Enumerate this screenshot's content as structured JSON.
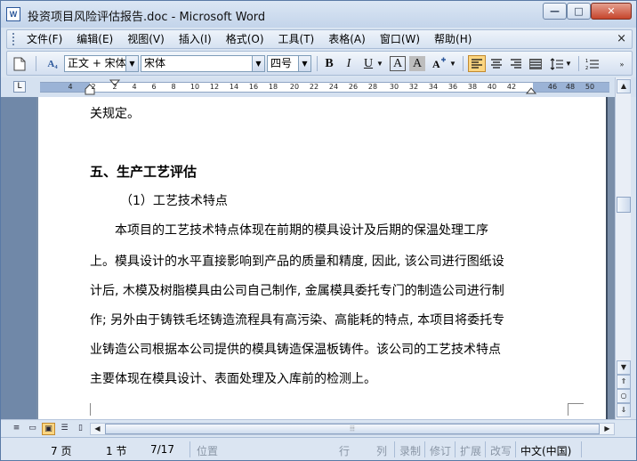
{
  "window": {
    "title": "投资项目风险评估报告.doc - Microsoft Word",
    "icon_label": "W",
    "minimize": "—",
    "maximize": "□",
    "close": "✕"
  },
  "menu": {
    "items": [
      "文件(F)",
      "编辑(E)",
      "视图(V)",
      "插入(I)",
      "格式(O)",
      "工具(T)",
      "表格(A)",
      "窗口(W)",
      "帮助(H)"
    ],
    "close": "×"
  },
  "toolbar": {
    "style_value": "正文 + 宋体",
    "font_value": "宋体",
    "size_value": "四号",
    "bold": "B",
    "italic": "I",
    "underline": "U",
    "char_border": "A",
    "char_shading": "A",
    "style_icon": "A₄"
  },
  "ruler": {
    "corner": "L",
    "ticks": [
      "4",
      "2",
      "2",
      "4",
      "6",
      "8",
      "10",
      "12",
      "14",
      "16",
      "18",
      "20",
      "22",
      "24",
      "26",
      "28",
      "30",
      "32",
      "34",
      "36",
      "38",
      "40",
      "42",
      "46",
      "48",
      "50"
    ]
  },
  "document": {
    "line1": "关规定。",
    "heading": "五、生产工艺评估",
    "subheading": "（1）工艺技术特点",
    "para": [
      "　　本项目的工艺技术特点体现在前期的模具设计及后期的保温处理工序",
      "上。模具设计的水平直接影响到产品的质量和精度, 因此, 该公司进行图纸设",
      "计后, 木模及树脂模具由公司自己制作, 金属模具委托专门的制造公司进行制",
      "作; 另外由于铸铁毛坯铸造流程具有高污染、高能耗的特点, 本项目将委托专",
      "业铸造公司根据本公司提供的模具铸造保温板铸件。该公司的工艺技术特点",
      "主要体现在模具设计、表面处理及入库前的检测上。"
    ]
  },
  "status": {
    "page": "7 页",
    "section": "1 节",
    "pos": "7/17",
    "at": "位置",
    "line": "行",
    "col": "列",
    "rec": "录制",
    "trk": "修订",
    "ext": "扩展",
    "ovr": "改写",
    "lang": "中文(中国)"
  }
}
